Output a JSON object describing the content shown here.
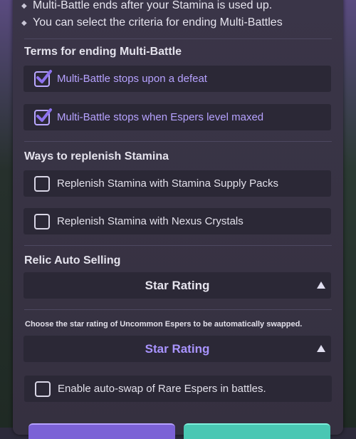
{
  "notes": [
    "Multi-Battle ends after your Stamina is used up.",
    "You can select the criteria for ending Multi-Battles"
  ],
  "terms": {
    "title": "Terms for ending Multi-Battle",
    "options": [
      {
        "label": "Multi-Battle stops upon a defeat",
        "checked": true
      },
      {
        "label": "Multi-Battle stops when Espers level maxed",
        "checked": true
      }
    ]
  },
  "replenish": {
    "title": "Ways to replenish Stamina",
    "options": [
      {
        "label": "Replenish Stamina with Stamina Supply Packs",
        "checked": false
      },
      {
        "label": "Replenish Stamina with Nexus Crystals",
        "checked": false
      }
    ]
  },
  "relic": {
    "title": "Relic Auto Selling",
    "dropdown_label": "Star Rating"
  },
  "uncommon": {
    "hint": "Choose the star rating of Uncommon Espers to be automatically swapped.",
    "dropdown_label": "Star Rating"
  },
  "rare": {
    "label": "Enable auto-swap of Rare Espers in battles.",
    "checked": false
  },
  "colors": {
    "accent": "#b6a2ff",
    "checked_box": "#7b61d6",
    "panel": "#383344",
    "row_bg": "#2b2836",
    "confirm": "#49c7b3"
  }
}
